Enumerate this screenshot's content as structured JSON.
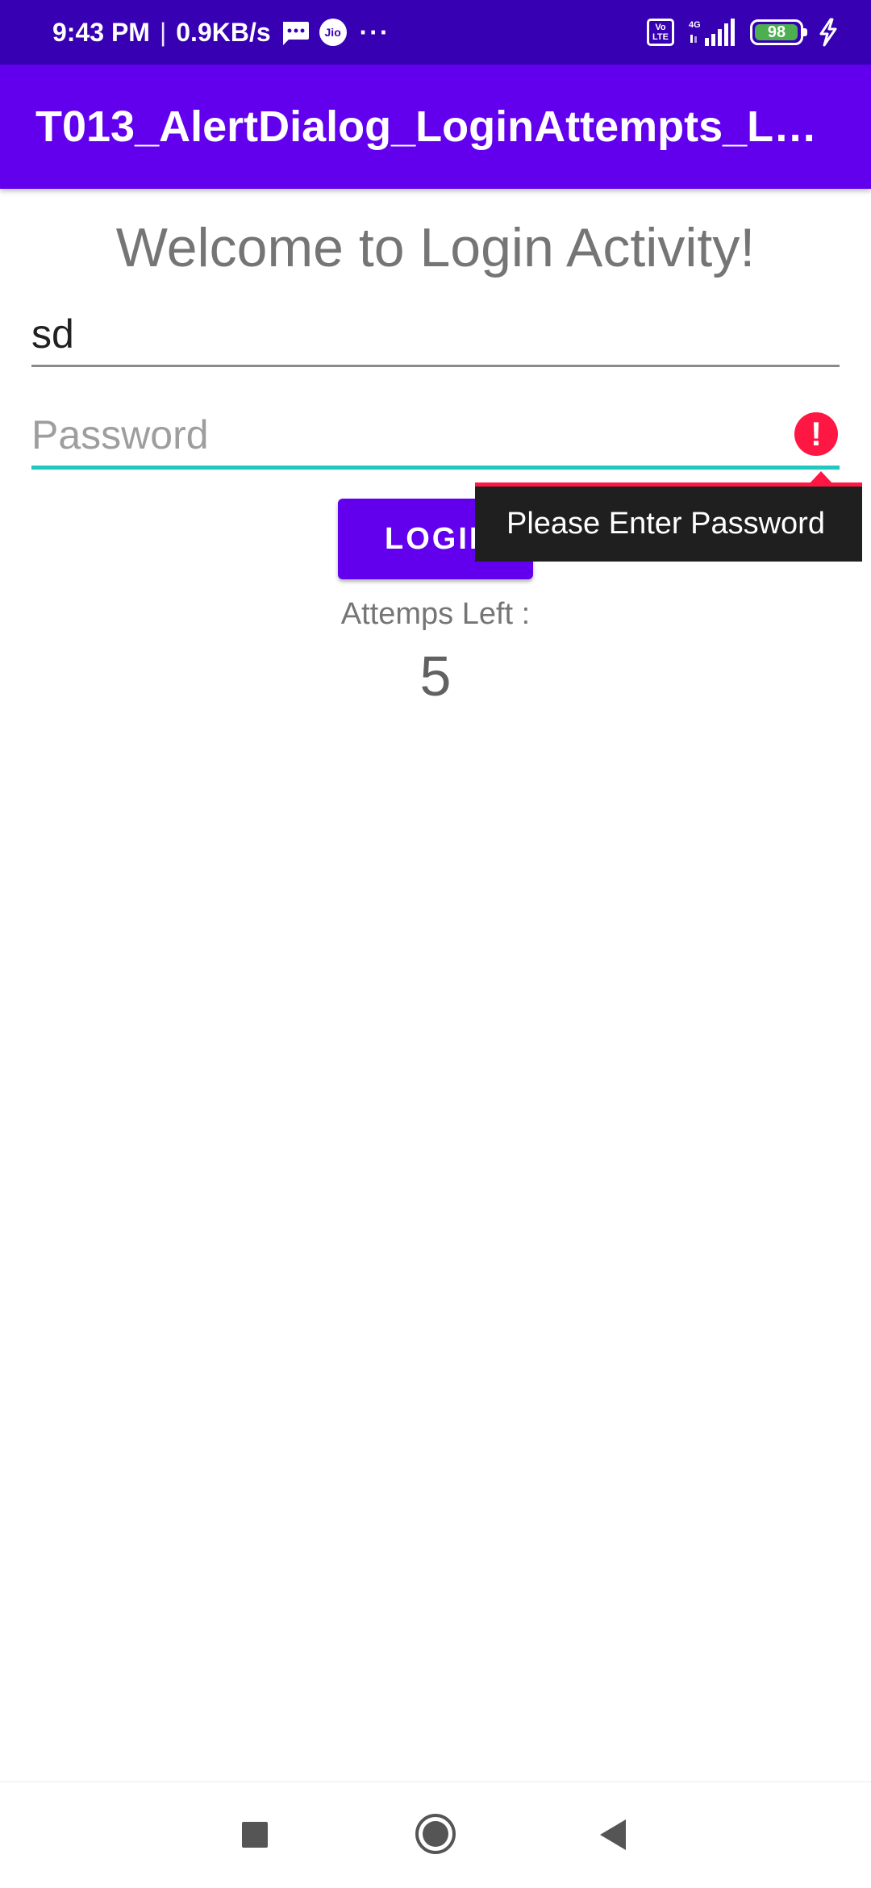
{
  "status_bar": {
    "time": "9:43 PM",
    "separator": "|",
    "net_speed": "0.9KB/s",
    "jio_label": "Jio",
    "more": "···",
    "volte_line1": "Vo",
    "volte_line2": "LTE",
    "network_type": "4G",
    "battery_level": "98",
    "battery_fraction": 0.98,
    "icons": [
      "message-icon",
      "jio-icon",
      "more-icon",
      "volte-icon",
      "signal-icon",
      "battery-icon",
      "charging-icon"
    ]
  },
  "app_bar": {
    "title": "T013_AlertDialog_LoginAttempts_L…"
  },
  "main": {
    "welcome": "Welcome to Login Activity!",
    "username_value": "sd",
    "password_placeholder": "Password",
    "error_message": "Please Enter Password",
    "login_label": "LOGIN",
    "attempts_label": "Attemps Left :",
    "attempts_value": "5"
  },
  "colors": {
    "status_bar": "#3700b3",
    "app_bar": "#6200ee",
    "button": "#6200ee",
    "field_focus": "#1dc9c0",
    "error": "#ff1744"
  },
  "nav_bar": {
    "icons": [
      "recents-icon",
      "home-icon",
      "back-icon"
    ]
  }
}
